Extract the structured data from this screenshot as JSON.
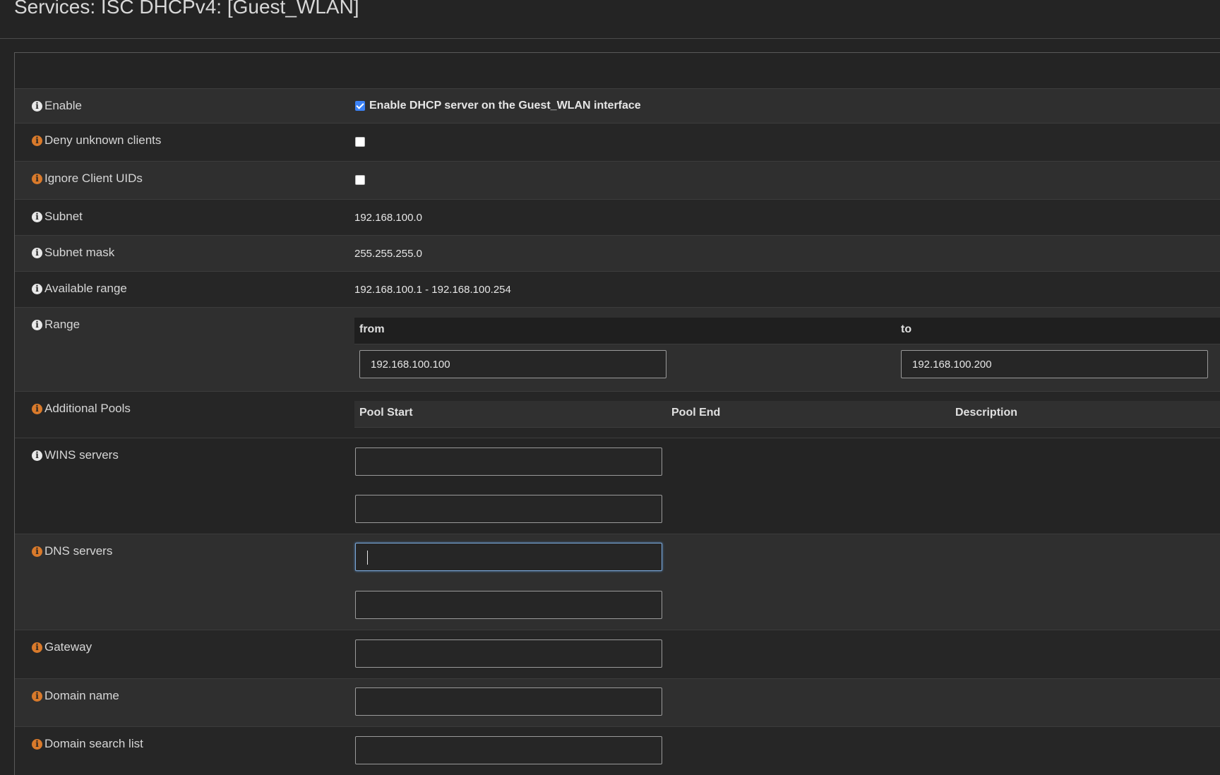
{
  "header": {
    "title": "Services: ISC DHCPv4: [Guest_WLAN]"
  },
  "fields": {
    "enable": {
      "label": "Enable",
      "checked": true,
      "checkbox_label": "Enable DHCP server on the Guest_WLAN interface",
      "icon": "info-icon"
    },
    "deny_unknown": {
      "label": "Deny unknown clients",
      "checked": false,
      "icon": "info-icon"
    },
    "ignore_uids": {
      "label": "Ignore Client UIDs",
      "checked": false,
      "icon": "info-icon"
    },
    "subnet": {
      "label": "Subnet",
      "value": "192.168.100.0",
      "icon": "info-icon"
    },
    "subnet_mask": {
      "label": "Subnet mask",
      "value": "255.255.255.0",
      "icon": "info-icon"
    },
    "available_range": {
      "label": "Available range",
      "value": "192.168.100.1 - 192.168.100.254",
      "icon": "info-icon"
    },
    "range": {
      "label": "Range",
      "from_header": "from",
      "to_header": "to",
      "from_value": "192.168.100.100",
      "to_value": "192.168.100.200",
      "icon": "info-icon"
    },
    "additional_pools": {
      "label": "Additional Pools",
      "columns": [
        "Pool Start",
        "Pool End",
        "Description"
      ],
      "icon": "info-icon"
    },
    "wins_servers": {
      "label": "WINS servers",
      "values": [
        "",
        ""
      ],
      "icon": "info-icon"
    },
    "dns_servers": {
      "label": "DNS servers",
      "values": [
        "",
        ""
      ],
      "icon": "info-icon"
    },
    "gateway": {
      "label": "Gateway",
      "value": "",
      "icon": "info-icon"
    },
    "domain_name": {
      "label": "Domain name",
      "value": "",
      "icon": "info-icon"
    },
    "domain_search_list": {
      "label": "Domain search list",
      "value": "",
      "icon": "info-icon"
    }
  },
  "colors": {
    "background": "#242424",
    "row_alt": "#2f2f2f",
    "info_white": "#e8e8e8",
    "info_orange": "#d97a2b",
    "checkbox_blue": "#3b82f6"
  }
}
